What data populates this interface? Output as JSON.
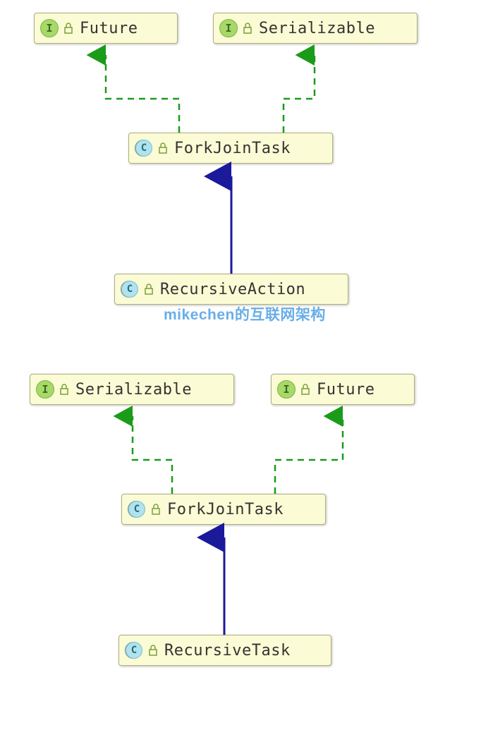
{
  "diagram": {
    "top": {
      "future": {
        "type": "I",
        "label": "Future"
      },
      "serializable": {
        "type": "I",
        "label": "Serializable"
      },
      "forkjointask": {
        "type": "C",
        "label": "ForkJoinTask"
      },
      "recursiveaction": {
        "type": "C",
        "label": "RecursiveAction"
      }
    },
    "bottom": {
      "serializable": {
        "type": "I",
        "label": "Serializable"
      },
      "future": {
        "type": "I",
        "label": "Future"
      },
      "forkjointask": {
        "type": "C",
        "label": "ForkJoinTask"
      },
      "recursivetask": {
        "type": "C",
        "label": "RecursiveTask"
      }
    }
  },
  "watermark": "mikechen的互联网架构",
  "colors": {
    "node_fill": "#fbfbd5",
    "node_border": "#b0b080",
    "interface_badge": "#a7d86a",
    "class_badge": "#aee3ef",
    "implements_arrow": "#1a9b1a",
    "extends_arrow": "#1a1a9b"
  }
}
